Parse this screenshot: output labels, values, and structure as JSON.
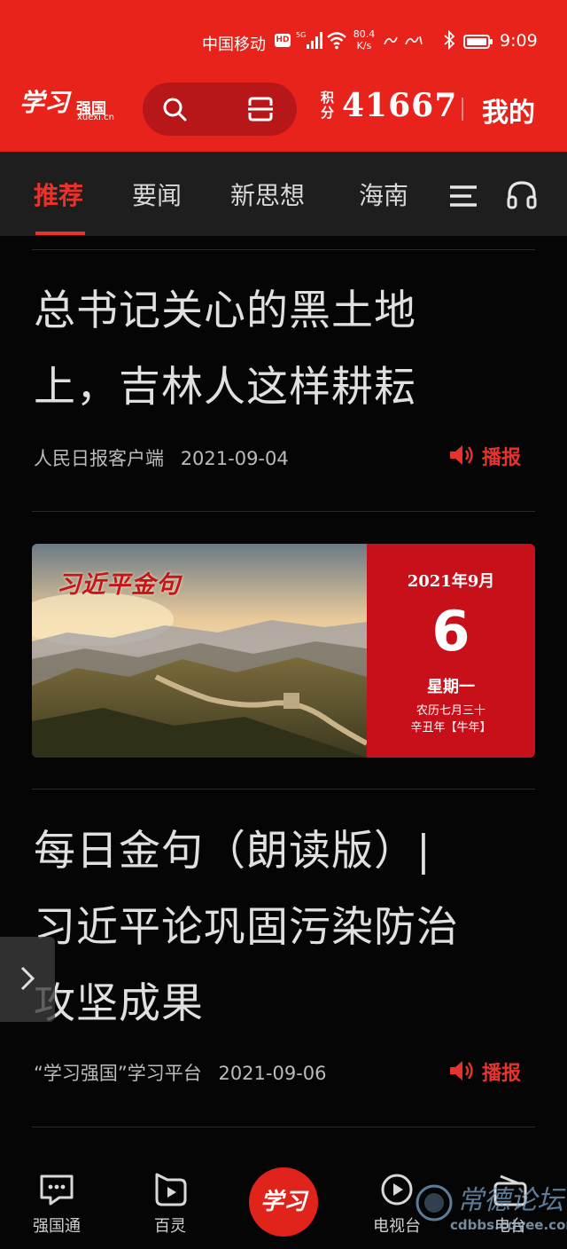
{
  "status_bar": {
    "carrier": "中国移动",
    "hd": "HD",
    "net_type": "5G",
    "speed_value": "80.4",
    "speed_unit": "K/s",
    "time": "9:09"
  },
  "header": {
    "logo_script": "学习",
    "logo_cn": "强国",
    "logo_url": "xuexi.cn",
    "points_label": "积分",
    "points_value": "41667",
    "mine_label": "我的"
  },
  "tabs": [
    {
      "label": "推荐",
      "active": true
    },
    {
      "label": "要闻",
      "active": false
    },
    {
      "label": "新思想",
      "active": false
    },
    {
      "label": "海南",
      "active": false
    }
  ],
  "articles": [
    {
      "title_line1": "总书记关心的黑土地",
      "title_line2": "上，吉林人这样耕耘",
      "source": "人民日报客户端",
      "date": "2021-09-04",
      "play_label": "播报"
    },
    {
      "title_line1": "每日金句（朗读版）|",
      "title_line2": "习近平论巩固污染防治",
      "title_line3": "攻坚成果",
      "source": "“学习强国”学习平台",
      "date": "2021-09-06",
      "play_label": "播报"
    }
  ],
  "banner": {
    "title": "习近平金句",
    "year_month": "2021年9月",
    "day": "6",
    "weekday": "星期一",
    "lunar": "农历七月三十",
    "ganzhi": "辛丑年【牛年】"
  },
  "bottom_nav": [
    {
      "label": "强国通",
      "icon": "chat-icon"
    },
    {
      "label": "百灵",
      "icon": "play-square-icon"
    },
    {
      "label": "学习",
      "icon": "center-logo"
    },
    {
      "label": "电视台",
      "icon": "play-circle-icon"
    },
    {
      "label": "电台",
      "icon": "radio-icon"
    }
  ],
  "watermark": {
    "text": "常德论坛",
    "url": "cdbbs.cdyee.com"
  },
  "colors": {
    "brand_red": "#e8231b",
    "accent_red": "#e8332c",
    "background": "#050505"
  }
}
